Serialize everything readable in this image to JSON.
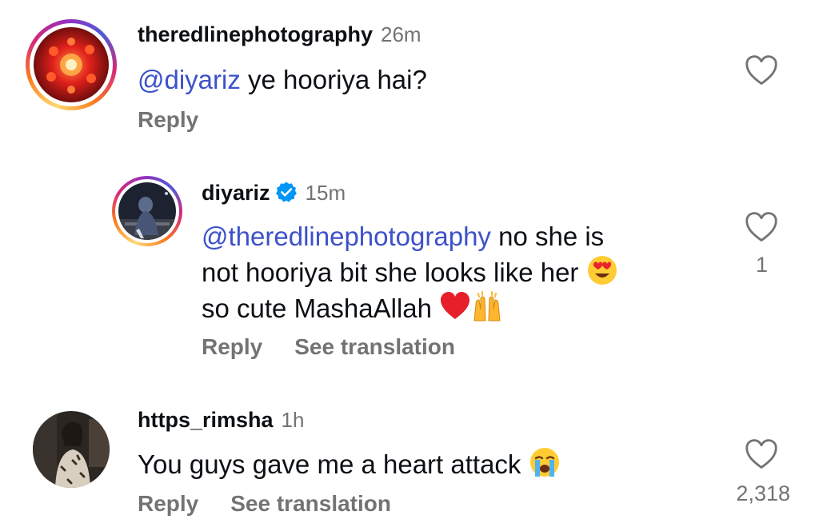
{
  "comments": [
    {
      "username": "theredlinephotography",
      "time": "26m",
      "mention": "@diyariz",
      "text": " ye hooriya hai?",
      "reply_label": "Reply",
      "likes": ""
    },
    {
      "username": "diyariz",
      "time": "15m",
      "mention": "@theredlinephotography",
      "text_line1": " no she is",
      "text_line2": "not hooriya bit she looks like her",
      "text_line3": "so cute MashaAllah",
      "reply_label": "Reply",
      "translate_label": "See translation",
      "likes": "1"
    },
    {
      "username": "https_rimsha",
      "time": "1h",
      "text": "You guys gave me a heart attack",
      "reply_label": "Reply",
      "translate_label": "See translation",
      "likes": "2,318"
    }
  ],
  "icons": {
    "like": "heart-outline-icon",
    "verified": "verified-badge-icon",
    "emoji_heart_eyes": "heart-eyes-emoji",
    "emoji_red_heart": "red-heart-emoji",
    "emoji_raising_hands": "raising-hands-emoji",
    "emoji_crying": "loudly-crying-emoji"
  },
  "colors": {
    "mention": "#3d51c9",
    "secondary_text": "#737373",
    "verified": "#0095f6"
  }
}
